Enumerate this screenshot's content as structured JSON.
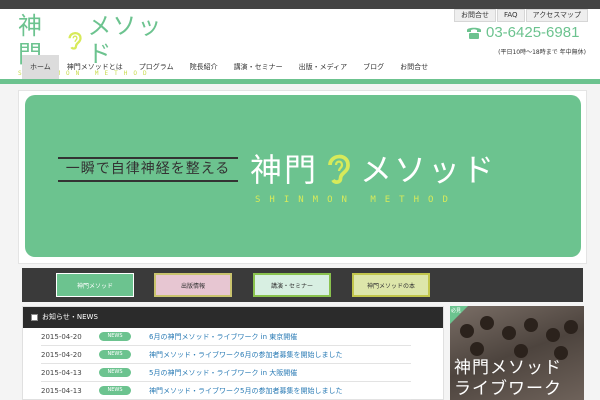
{
  "logo": {
    "main_left": "神門",
    "main_right": "メソッド",
    "sub": "SHINMON METHOD"
  },
  "util_links": [
    "お問合せ",
    "FAQ",
    "アクセスマップ"
  ],
  "phone": {
    "number": "03-6425-6981",
    "icon": "phone-icon",
    "hours": "(平日10時〜18時まで 年中無休)"
  },
  "nav": [
    "ホーム",
    "神門メソッドとは",
    "プログラム",
    "院長紹介",
    "講演・セミナー",
    "出版・メディア",
    "ブログ",
    "お問合せ"
  ],
  "hero": {
    "tagline": "一瞬で自律神経を整える",
    "title_left": "神門",
    "title_right": "メソッド",
    "subtitle": "SHINMON METHOD"
  },
  "thumbs": [
    "神門メソッド",
    "出版情報",
    "講演・セミナー",
    "神門メソッドの本"
  ],
  "news": {
    "heading": "お知らせ・NEWS",
    "items": [
      {
        "date": "2015-04-20",
        "badge": "NEWS",
        "text": "6月の神門メソッド・ライブワーク in 東京開催"
      },
      {
        "date": "2015-04-20",
        "badge": "NEWS",
        "text": "神門メソッド・ライブワーク6月の参加者募集を開始しました"
      },
      {
        "date": "2015-04-13",
        "badge": "NEWS",
        "text": "5月の神門メソッド・ライブワーク in 大阪開催"
      },
      {
        "date": "2015-04-13",
        "badge": "NEWS",
        "text": "神門メソッド・ライブワーク5月の参加者募集を開始しました"
      }
    ]
  },
  "side_banner": {
    "corner": "必見",
    "title_line1": "神門メソッド",
    "title_line2": "ライブワーク"
  },
  "colors": {
    "brand_green": "#6cc38f",
    "accent_yellow": "#d7ea5a",
    "dark": "#2b2b2b",
    "link": "#2a7bb5"
  }
}
